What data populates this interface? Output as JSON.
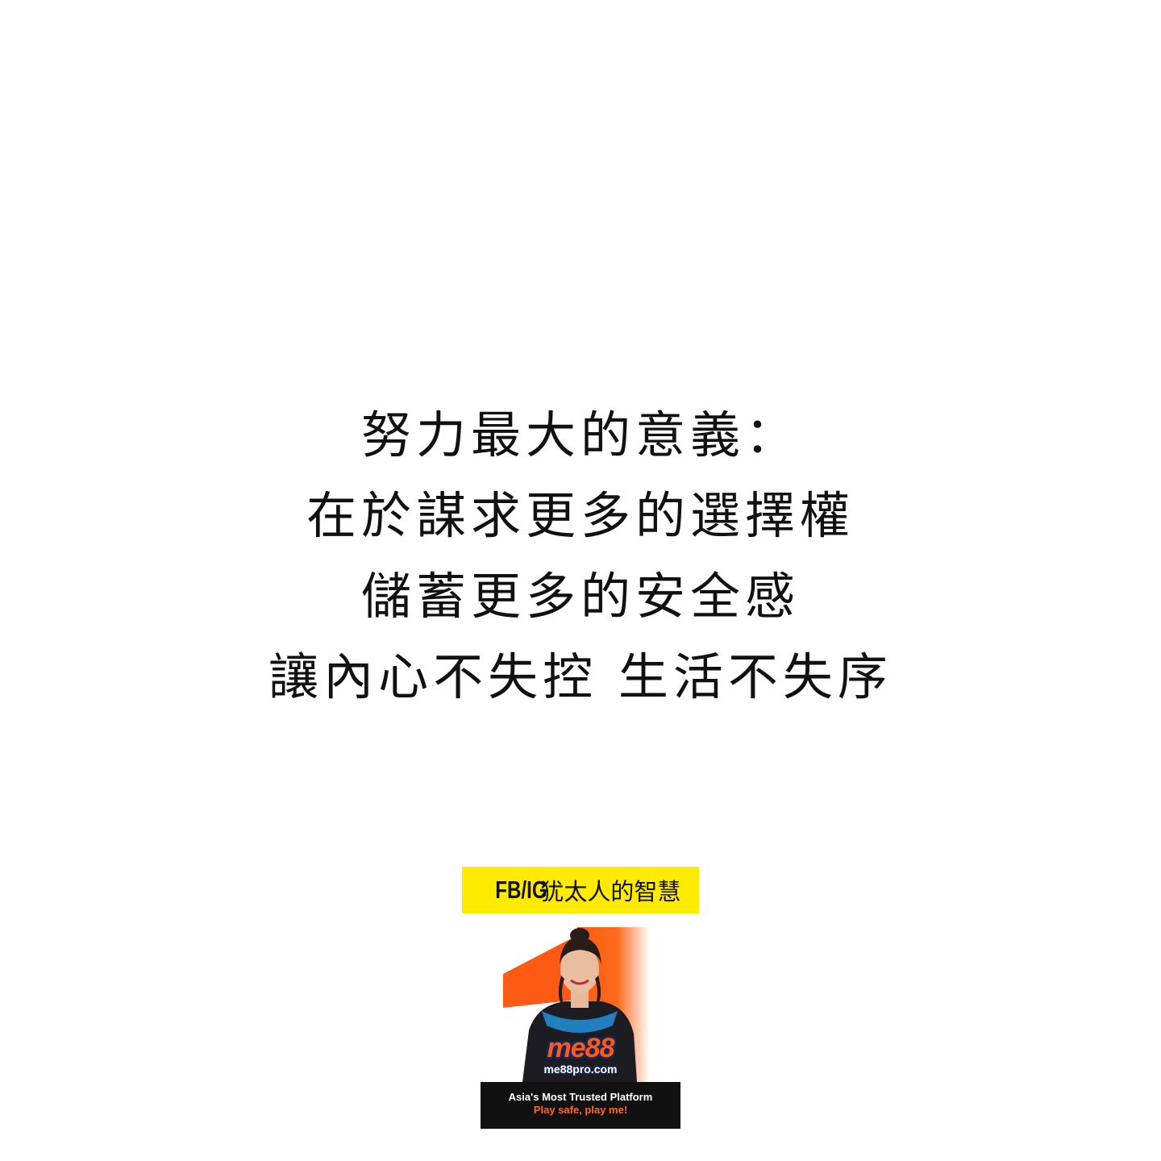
{
  "quote": {
    "lines": [
      "努力最大的意義：",
      "在於謀求更多的選擇權",
      "儲蓄更多的安全感",
      "讓內心不失控 生活不失序"
    ]
  },
  "tag": {
    "prefix": "FB/IG",
    "name": "犹太人的智慧"
  },
  "ad": {
    "brand": "me88",
    "site": "me88pro.com",
    "tagline": "Asia's Most Trusted Platform",
    "slogan": "Play safe, play me!",
    "colors": {
      "accent": "#ff5a14",
      "brand_outline": "#14285a",
      "bar": "#111111"
    }
  }
}
